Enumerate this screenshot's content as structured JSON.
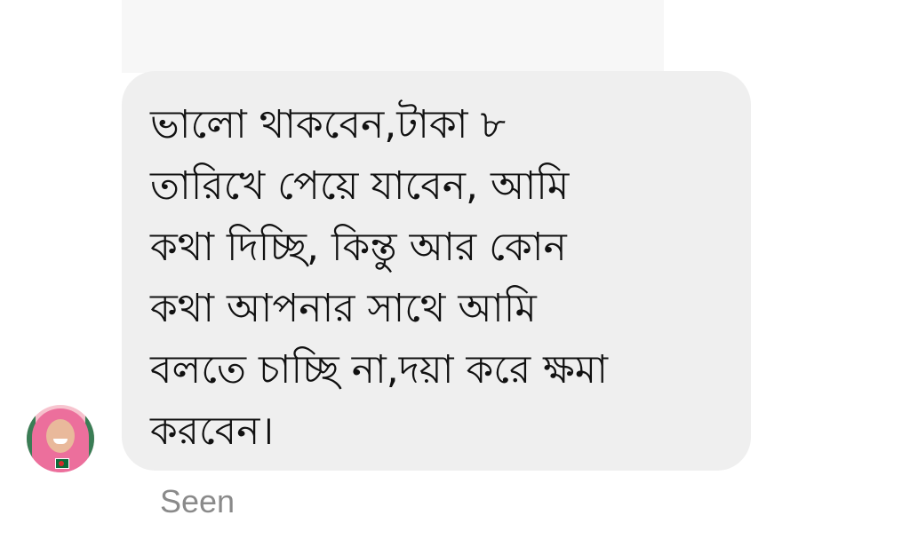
{
  "thread": {
    "message": {
      "text": "ভালো থাকবেন,টাকা ৮\nতারিখে পেয়ে যাবেন, আমি\nকথা দিচ্ছি, কিন্তু আর কোন\nকথা আপনার সাথে আমি\nবলতে চাচ্ছি না,দয়া করে ক্ষমা\nকরবেন।",
      "bubble_color": "#efefef"
    },
    "avatar": {
      "icon": "profile-photo-avatar"
    },
    "status": {
      "label": "Seen"
    }
  }
}
